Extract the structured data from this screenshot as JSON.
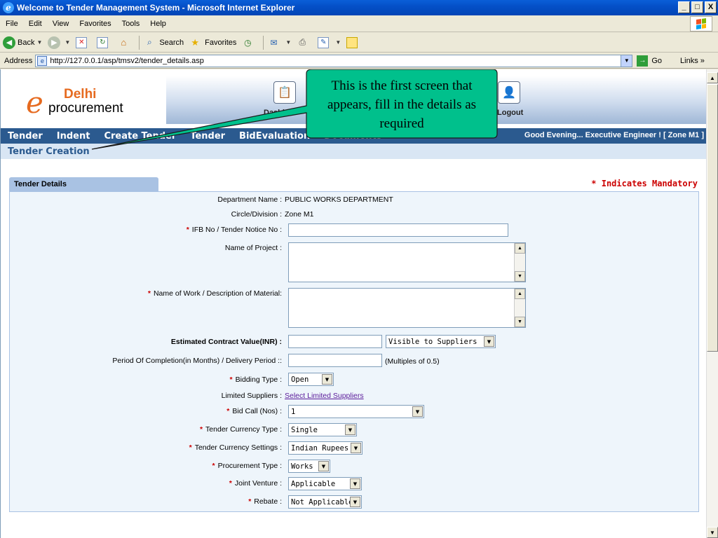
{
  "window": {
    "title": "Welcome to Tender Management System - Microsoft Internet Explorer",
    "min": "_",
    "max": "□",
    "close": "X"
  },
  "menu": {
    "items": [
      {
        "label": "File"
      },
      {
        "label": "Edit"
      },
      {
        "label": "View"
      },
      {
        "label": "Favorites"
      },
      {
        "label": "Tools"
      },
      {
        "label": "Help"
      }
    ]
  },
  "toolbar": {
    "back": "Back",
    "search": "Search",
    "favorites": "Favorites"
  },
  "address": {
    "label": "Address",
    "url": "http://127.0.0.1/asp/tmsv2/tender_details.asp",
    "go": "Go",
    "links": "Links"
  },
  "site": {
    "logo_delhi": "Delhi",
    "logo_procurement": "procurement",
    "dashboard_label": "Dashb",
    "logout_label": "Logout",
    "nav": [
      {
        "label": "Tender"
      },
      {
        "label": "Indent"
      },
      {
        "label": "Create Tender"
      },
      {
        "label": "Tender"
      },
      {
        "label": "BidEvaluation"
      },
      {
        "label": "Documents"
      }
    ],
    "greeting": "Good Evening...  Executive Engineer !   [ Zone M1 ]",
    "breadcrumb": "Tender Creation"
  },
  "callout": {
    "text": "This is the first screen that appears, fill in the details as required",
    "fill": "#00c08c"
  },
  "form": {
    "tab_title": "Tender Details",
    "mandatory_note": "* Indicates Mandatory",
    "department_label": "Department Name :",
    "department_value": "PUBLIC WORKS DEPARTMENT",
    "circle_label": "Circle/Division :",
    "circle_value": "Zone M1",
    "ifb_label": "IFB No / Tender Notice No :",
    "project_label": "Name of Project :",
    "work_label": "Name of Work / Description of Material:",
    "ecv_label": "Estimated Contract Value(INR) :",
    "ecv_visibility": "Visible to Suppliers",
    "period_label": "Period Of Completion(in Months) / Delivery Period ::",
    "period_hint": "(Multiples of 0.5)",
    "bidding_label": "Bidding Type :",
    "bidding_value": "Open",
    "limited_label": "Limited Suppliers :",
    "limited_link": "Select Limited Suppliers",
    "bidcall_label": "Bid Call (Nos) :",
    "bidcall_value": "1",
    "currency_type_label": "Tender Currency Type :",
    "currency_type_value": "Single",
    "currency_settings_label": "Tender Currency Settings :",
    "currency_settings_value": "Indian Rupees",
    "procurement_label": "Procurement Type :",
    "procurement_value": "Works",
    "jv_label": "Joint Venture :",
    "jv_value": "Applicable",
    "rebate_label": "Rebate :",
    "rebate_value": "Not Applicable",
    "star": "*"
  },
  "icons": {
    "dashboard": "dashboard-icon",
    "logout": "logout-icon",
    "back": "back-arrow-icon",
    "search": "search-icon",
    "favorites": "star-icon"
  }
}
